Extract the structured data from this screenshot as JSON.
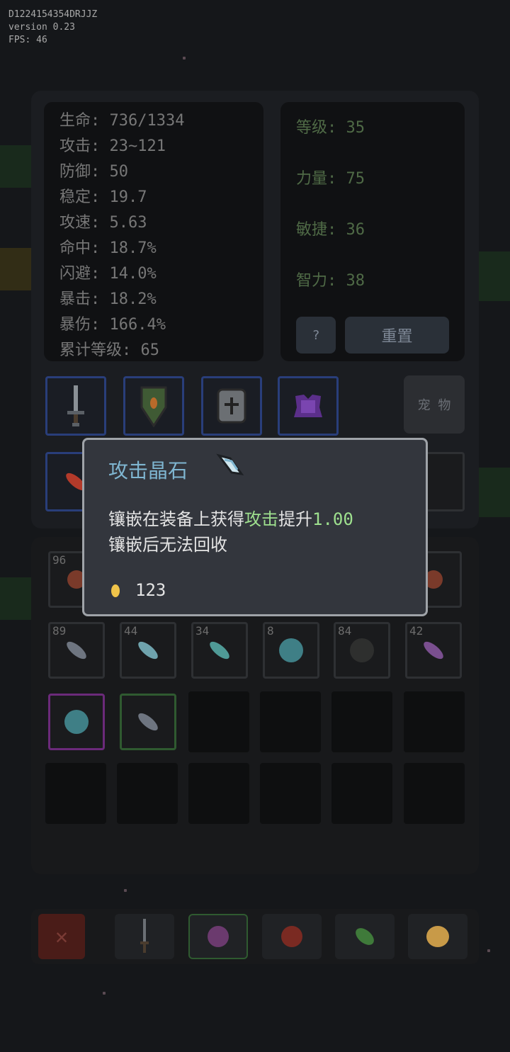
{
  "debug": {
    "device_id": "D1224154354DRJJZ",
    "version": "version 0.23",
    "fps": "FPS: 46"
  },
  "stats": [
    "生命: 736/1334",
    "攻击: 23~121",
    "防御: 50",
    "稳定: 19.7",
    "攻速: 5.63",
    "命中: 18.7%",
    "闪避: 14.0%",
    "暴击: 18.2%",
    "暴伤: 166.4%",
    "累计等级: 65"
  ],
  "attributes": [
    "等级: 35",
    "力量: 75",
    "敏捷: 36",
    "智力: 38"
  ],
  "buttons": {
    "help": "?",
    "reset": "重置",
    "pet": "宠 物"
  },
  "equipment_slots": [
    "sword-icon",
    "shield-icon",
    "helmet-icon",
    "armor-icon"
  ],
  "inventory": {
    "row1": [
      {
        "count": "96"
      }
    ],
    "row2": [
      {
        "count": "89",
        "item": "gray-crystal-icon"
      },
      {
        "count": "44",
        "item": "teal-crystal-icon"
      },
      {
        "count": "34",
        "item": "teal-shard-icon"
      },
      {
        "count": "8",
        "item": "teal-orb-icon"
      },
      {
        "count": "84",
        "item": "dark-orb-icon"
      },
      {
        "count": "42",
        "item": "purple-crystal-icon"
      }
    ]
  },
  "tooltip": {
    "title": "攻击晶石",
    "desc_prefix": "镶嵌在装备上获得",
    "desc_highlight": "攻击",
    "desc_mid": "提升",
    "desc_value": "1.00",
    "desc_line2": "镶嵌后无法回收",
    "price": "123"
  },
  "bottom_tabs": [
    "close-icon",
    "sword-icon",
    "gem-icon",
    "potion-icon",
    "herb-icon",
    "egg-icon"
  ],
  "colors": {
    "highlight": "#9ee08e",
    "title": "#7fb6d1",
    "equip_border": "#293e7a"
  }
}
